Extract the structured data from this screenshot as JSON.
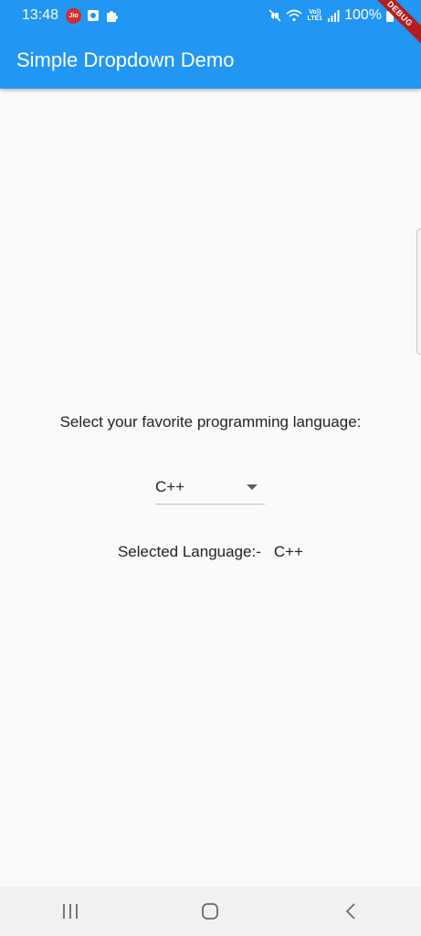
{
  "status_bar": {
    "time": "13:48",
    "carrier_badge": "Jio",
    "volte_line1": "Vo))",
    "volte_line2": "LTE1",
    "battery": "100%"
  },
  "debug_banner": "DEBUG",
  "app_bar": {
    "title": "Simple Dropdown Demo",
    "color": "#2196f3"
  },
  "content": {
    "prompt": "Select your favorite programming language:",
    "dropdown": {
      "selected": "C++"
    },
    "selected_label": "Selected Language:-",
    "selected_value": "C++"
  },
  "nav_bar": {
    "icons": [
      "recent-apps-icon",
      "home-icon",
      "back-icon"
    ]
  }
}
